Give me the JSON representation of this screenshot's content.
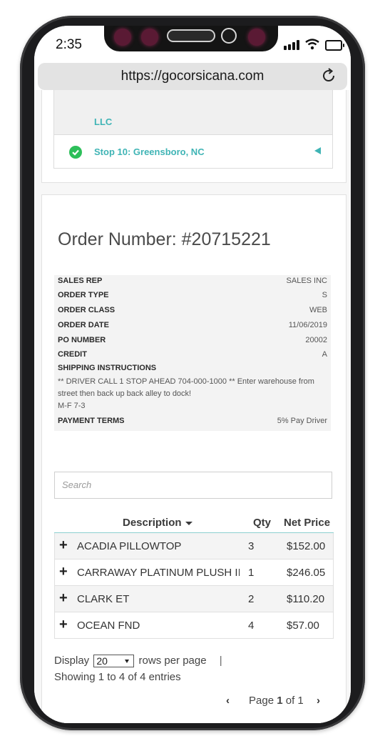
{
  "status": {
    "time": "2:35"
  },
  "browser": {
    "url": "https://gocorsicana.com"
  },
  "stops": {
    "prev_label_tail": "LLC",
    "current": "Stop 10: Greensboro, NC"
  },
  "order": {
    "title": "Order Number: #20715221",
    "fields": [
      {
        "label": "SALES REP",
        "value": "SALES INC"
      },
      {
        "label": "ORDER TYPE",
        "value": "S"
      },
      {
        "label": "ORDER CLASS",
        "value": "WEB"
      },
      {
        "label": "ORDER DATE",
        "value": "11/06/2019"
      },
      {
        "label": "PO NUMBER",
        "value": "20002"
      },
      {
        "label": "CREDIT",
        "value": "A"
      }
    ],
    "shipping_label": "SHIPPING INSTRUCTIONS",
    "shipping_line1": "** DRIVER CALL 1 STOP AHEAD 704-000-1000 ** Enter warehouse from street then back up back alley to dock!",
    "shipping_line2": "M-F 7-3",
    "payment_label": "PAYMENT TERMS",
    "payment_value": "5% Pay Driver"
  },
  "search": {
    "placeholder": "Search"
  },
  "table": {
    "headers": {
      "description": "Description",
      "qty": "Qty",
      "price": "Net Price"
    },
    "rows": [
      {
        "description": "ACADIA PILLOWTOP",
        "qty": "3",
        "price": "$152.00"
      },
      {
        "description": "CARRAWAY PLATINUM PLUSH II",
        "qty": "1",
        "price": "$246.05"
      },
      {
        "description": "CLARK ET",
        "qty": "2",
        "price": "$110.20"
      },
      {
        "description": "OCEAN FND",
        "qty": "4",
        "price": "$57.00"
      }
    ]
  },
  "footer": {
    "display_prefix": "Display",
    "rows_value": "20",
    "display_suffix": "rows per page",
    "pipe": "|",
    "showing": "Showing 1 to 4 of 4 entries",
    "page_word": "Page",
    "page_current": "1",
    "page_of": "of 1"
  },
  "colors": {
    "accent": "#3fb4b5",
    "success": "#2dbf5a"
  }
}
